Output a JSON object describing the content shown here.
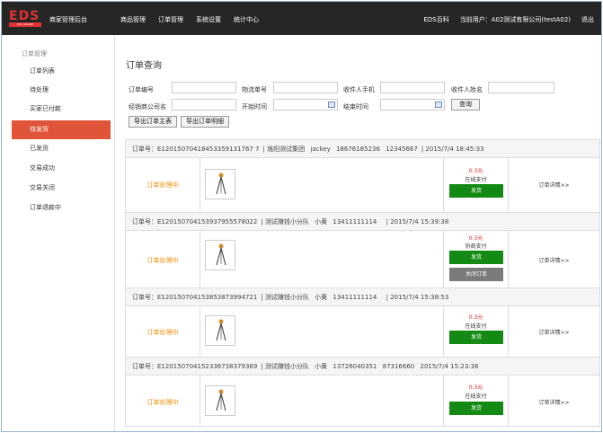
{
  "topbar": {
    "logo_text": "EDS",
    "logo_sub": "EDS ONLINE",
    "brand": "商家管理后台",
    "nav": [
      "商品管理",
      "订单管理",
      "系统设置",
      "统计中心"
    ],
    "right": {
      "wiki": "EDS百科",
      "current_user": "当前用户：A02测试有限公司(testA02)",
      "logout": "退出"
    }
  },
  "sidebar": {
    "title": "订单管理",
    "items": [
      {
        "label": "订单列表",
        "active": false
      },
      {
        "label": "待处理",
        "active": false
      },
      {
        "label": "买家已付款",
        "active": false
      },
      {
        "label": "待发货",
        "active": true
      },
      {
        "label": "已发货",
        "active": false
      },
      {
        "label": "交易成功",
        "active": false
      },
      {
        "label": "交易关闭",
        "active": false
      },
      {
        "label": "订单退款中",
        "active": false
      }
    ]
  },
  "query": {
    "title": "订单查询",
    "labels": {
      "order_no": "订单编号",
      "logistics_no": "物流单号",
      "receiver_phone": "收件人手机",
      "receiver_name": "收件人姓名",
      "dealer": "经销商公司名",
      "start_time": "开始时间",
      "end_time": "结束时间"
    },
    "buttons": {
      "search": "查询",
      "export_main": "导出订单主表",
      "export_detail": "导出订单明细"
    }
  },
  "orders": [
    {
      "order_no": "订单号：E12015070418453359131767 7",
      "group": "逸阳测试集团",
      "contact": "jackey",
      "phone": "18676185236",
      "extra": "12345667",
      "time": "2015/7/4 18:45:33",
      "status": "订单处理中",
      "price": "0.3元",
      "pay": "在线支付",
      "ship": "发货",
      "close": "",
      "detail": "订单详情>>"
    },
    {
      "order_no": "订单号：E120150704153937955578022",
      "group": "测试赚钱小分队",
      "contact": "小黄",
      "phone": "13411111114",
      "extra": "",
      "time": "2015/7/4 15:39:38",
      "status": "订单处理中",
      "price": "0.3元",
      "pay": "协商支付",
      "ship": "发货",
      "close": "关闭订单",
      "detail": "订单详情>>"
    },
    {
      "order_no": "订单号：E120150704153853873994721",
      "group": "测试赚钱小分队",
      "contact": "小黄",
      "phone": "13411111114",
      "extra": "",
      "time": "2015/7/4 15:38:53",
      "status": "订单处理中",
      "price": "0.3元",
      "pay": "在线支付",
      "ship": "发货",
      "close": "",
      "detail": "订单详情>>"
    },
    {
      "order_no": "订单号：E120150704152336738379369",
      "group": "测试赚钱小分队",
      "contact": "小黄",
      "phone": "13726040351",
      "extra": "87316660",
      "time": "2015/7/4 15:23:36",
      "status": "订单处理中",
      "price": "0.3元",
      "pay": "在线支付",
      "ship": "发货",
      "close": "",
      "detail": "订单详情>>"
    }
  ]
}
